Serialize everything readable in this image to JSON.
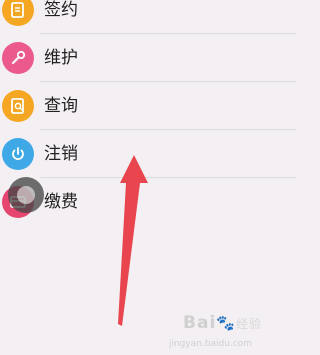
{
  "menu": {
    "items": [
      {
        "label": "签约",
        "icon": "contract-icon",
        "color": "#f5a623"
      },
      {
        "label": "维护",
        "icon": "wrench-icon",
        "color": "#ec5a8d"
      },
      {
        "label": "查询",
        "icon": "search-doc-icon",
        "color": "#f5a623"
      },
      {
        "label": "注销",
        "icon": "power-icon",
        "color": "#3fa9e8"
      },
      {
        "label": "缴费",
        "icon": "payment-card-icon",
        "color": "#e5456e"
      }
    ]
  },
  "watermark": {
    "brand": "Bai",
    "sub": "经验",
    "url": "jingyan.baidu.com"
  },
  "colors": {
    "arrow": "#e8323c"
  }
}
